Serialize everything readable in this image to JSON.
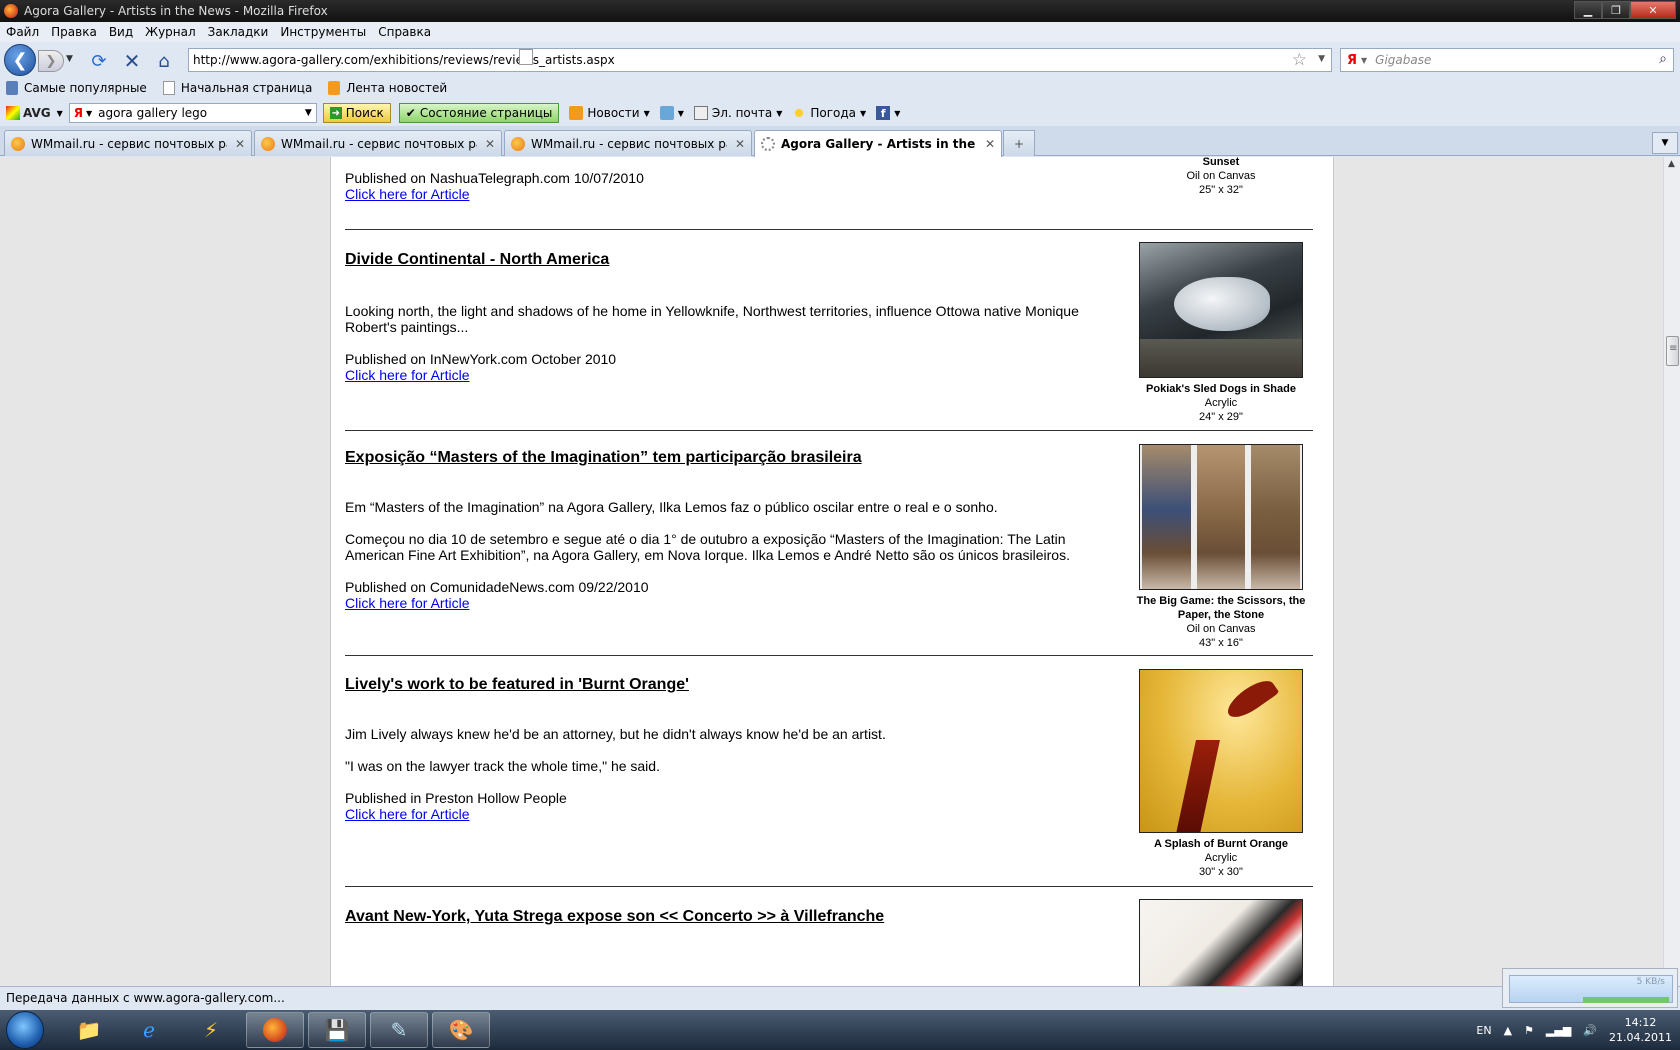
{
  "window": {
    "title": "Agora Gallery - Artists in the News - Mozilla Firefox",
    "controls": {
      "minimize": "▁",
      "maximize": "❐",
      "close": "✕"
    }
  },
  "menu": [
    "Файл",
    "Правка",
    "Вид",
    "Журнал",
    "Закладки",
    "Инструменты",
    "Справка"
  ],
  "nav": {
    "url": "http://www.agora-gallery.com/exhibitions/reviews/reviews_artists.aspx",
    "search_placeholder": "Gigabase",
    "icons": [
      "back-icon",
      "forward-icon",
      "reload-icon",
      "stop-icon",
      "home-icon",
      "star-icon",
      "search-icon"
    ]
  },
  "bookmarks": [
    "Самые популярные",
    "Начальная страница",
    "Лента новостей"
  ],
  "toolbar": {
    "avg_label": "AVG",
    "search_value": "agora gallery lego",
    "search_button": "Поиск",
    "status_button": "Состояние страницы",
    "news": "Новости",
    "mail": "Эл. почта",
    "weather": "Погода"
  },
  "tabs": [
    {
      "label": "WMmail.ru - сервис почтовых рас...",
      "active": false
    },
    {
      "label": "WMmail.ru - сервис почтовых рас...",
      "active": false
    },
    {
      "label": "WMmail.ru - сервис почтовых рас...",
      "active": false
    },
    {
      "label": "Agora Gallery - Artists in the News",
      "active": true
    }
  ],
  "articles": [
    {
      "published": "Published on NashuaTelegraph.com 10/07/2010",
      "link": "Click here for Article",
      "art": {
        "title": "Sunset",
        "medium": "Oil on Canvas",
        "size": "25\" x 32\""
      }
    },
    {
      "headline": "Divide Continental - North America",
      "paragraphs": [
        "Looking north, the light and shadows of he home in Yellowknife, Northwest territories, influence Ottowa native Monique Robert's paintings..."
      ],
      "published": "Published on InNewYork.com October 2010",
      "link": "Click here for Article",
      "art": {
        "title": "Pokiak's Sled Dogs in Shade",
        "medium": "Acrylic",
        "size": "24\" x 29\""
      }
    },
    {
      "headline": "Exposição “Masters of the Imagination” tem participarção brasileira",
      "paragraphs": [
        "Em “Masters of the Imagination” na Agora Gallery, Ilka Lemos faz o público oscilar entre o real e o sonho.",
        "Começou no dia 10 de setembro e segue até o dia 1° de outubro a exposição “Masters of the Imagination: The Latin American Fine Art Exhibition”, na Agora Gallery, em Nova Iorque. Ilka Lemos e André Netto são os únicos brasileiros."
      ],
      "published": "Published on ComunidadeNews.com 09/22/2010",
      "link": "Click here for Article",
      "art": {
        "title": "The Big Game: the Scissors, the Paper, the Stone",
        "medium": "Oil on Canvas",
        "size": "43\" x 16\""
      }
    },
    {
      "headline": "Lively's work to be featured in 'Burnt Orange'",
      "paragraphs": [
        "Jim Lively always knew he'd be an attorney, but he didn't always know he'd be an artist.",
        "\"I was on the lawyer track the whole time,\" he said."
      ],
      "published": "Published in Preston Hollow People",
      "link": "Click here for Article",
      "art": {
        "title": "A Splash of Burnt Orange",
        "medium": "Acrylic",
        "size": "30\" x 30\""
      }
    },
    {
      "headline": "Avant New-York, Yuta Strega expose son << Concerto >> à Villefranche"
    }
  ],
  "status": {
    "text": "Передача данных с www.agora-gallery.com...",
    "download_speed": "5 KB/s"
  },
  "taskbar": {
    "language": "EN",
    "time": "14:12",
    "date": "21.04.2011"
  }
}
